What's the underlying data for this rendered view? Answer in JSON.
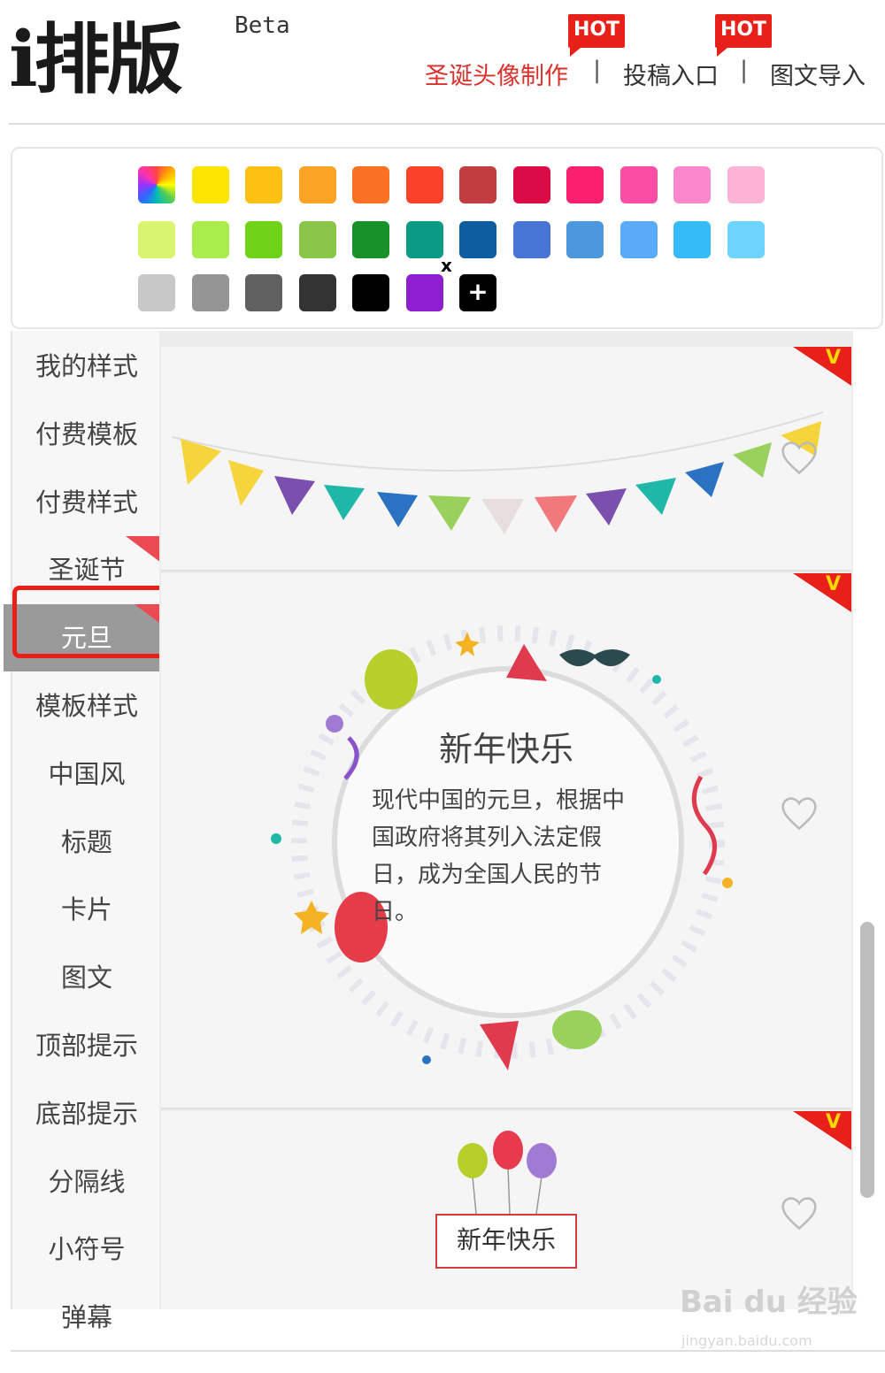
{
  "header": {
    "logo_text": "i排版",
    "logo_badge": "Beta",
    "nav": [
      {
        "label": "圣诞头像制作",
        "color": "#d9312c",
        "hot": "HOT"
      },
      {
        "label": "投稿入口",
        "color": "#333333",
        "hot": "HOT"
      },
      {
        "label": "图文导入",
        "color": "#333333",
        "hot": ""
      }
    ],
    "separator": "|"
  },
  "palette": {
    "rows": [
      [
        "rainbow",
        "#fee500",
        "#fdc013",
        "#fca425",
        "#fb7124",
        "#fb4127",
        "#c23d3f",
        "#db0b48",
        "#fb1f6f",
        "#fb4da4",
        "#fb87cc",
        "#fcb3d6"
      ],
      [
        "#d9f56f",
        "#a8ed4b",
        "#6ed316",
        "#88c548",
        "#199129",
        "#0b9a84",
        "#0f5da1",
        "#4775d4",
        "#4b98df",
        "#5aaafa",
        "#35bcf8",
        "#6fd4fd"
      ],
      [
        "#c8c8c8",
        "#959595",
        "#606060",
        "#333333",
        "#000000",
        "#8f1ed0",
        "add"
      ]
    ],
    "add_label": "+",
    "remove_label": "x"
  },
  "sidebar": {
    "items": [
      {
        "label": "我的样式"
      },
      {
        "label": "付费模板"
      },
      {
        "label": "付费样式"
      },
      {
        "label": "圣诞节"
      },
      {
        "label": "元旦"
      },
      {
        "label": "模板样式"
      },
      {
        "label": "中国风"
      },
      {
        "label": "标题"
      },
      {
        "label": "卡片"
      },
      {
        "label": "图文"
      },
      {
        "label": "顶部提示"
      },
      {
        "label": "底部提示"
      },
      {
        "label": "分隔线"
      },
      {
        "label": "小符号"
      },
      {
        "label": "弹幕"
      }
    ],
    "active_index": 4
  },
  "panels": {
    "vip_mark": "V",
    "card": {
      "title": "新年快乐",
      "body": "现代中国的元旦，根据中国政府将其列入法定假日，成为全国人民的节日。"
    },
    "box_title": "新年快乐"
  },
  "watermark": {
    "text": "Bai du 经验",
    "sub": "jingyan.baidu.com"
  }
}
